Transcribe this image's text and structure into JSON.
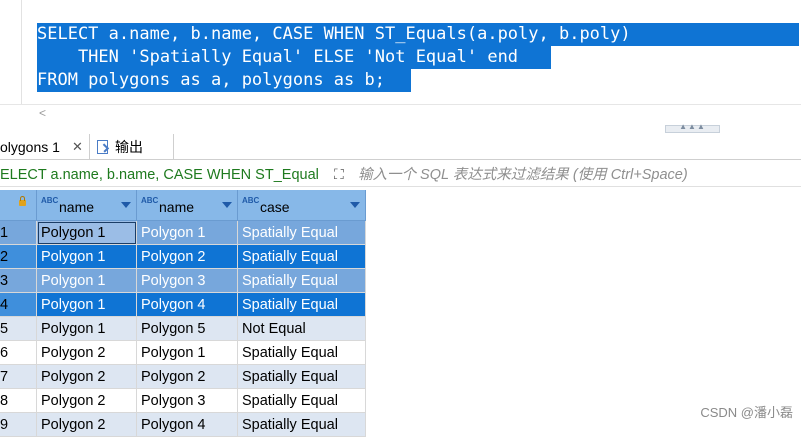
{
  "editor": {
    "sql_lines": [
      "SELECT a.name, b.name, CASE WHEN ST_Equals(a.poly, b.poly)",
      "    THEN 'Spatially Equal' ELSE 'Not Equal' end",
      "FROM polygons as a, polygons as b;"
    ],
    "scroll_left_arrow": "<",
    "sash_glyph": "▲▲▲"
  },
  "tabs": {
    "results_label": "olygons 1",
    "close_glyph": "✕",
    "output_label": "输出"
  },
  "filter": {
    "query_text": "ELECT a.name, b.name, CASE WHEN ST_Equal",
    "expand_glyph": "⛶",
    "placeholder": "输入一个 SQL 表达式来过滤结果 (使用 Ctrl+Space)"
  },
  "grid": {
    "columns": [
      {
        "type_badge": "ABC",
        "label": "name"
      },
      {
        "type_badge": "ABC",
        "label": "name"
      },
      {
        "type_badge": "ABC",
        "label": "case"
      }
    ],
    "rows": [
      {
        "num": "1",
        "a": "Polygon 1",
        "b": "Polygon 1",
        "case": "Spatially Equal"
      },
      {
        "num": "2",
        "a": "Polygon 1",
        "b": "Polygon 2",
        "case": "Spatially Equal"
      },
      {
        "num": "3",
        "a": "Polygon 1",
        "b": "Polygon 3",
        "case": "Spatially Equal"
      },
      {
        "num": "4",
        "a": "Polygon 1",
        "b": "Polygon 4",
        "case": "Spatially Equal"
      },
      {
        "num": "5",
        "a": "Polygon 1",
        "b": "Polygon 5",
        "case": "Not Equal"
      },
      {
        "num": "6",
        "a": "Polygon 2",
        "b": "Polygon 1",
        "case": "Spatially Equal"
      },
      {
        "num": "7",
        "a": "Polygon 2",
        "b": "Polygon 2",
        "case": "Spatially Equal"
      },
      {
        "num": "8",
        "a": "Polygon 2",
        "b": "Polygon 3",
        "case": "Spatially Equal"
      },
      {
        "num": "9",
        "a": "Polygon 2",
        "b": "Polygon 4",
        "case": "Spatially Equal"
      }
    ]
  },
  "watermark": "CSDN @潘小磊",
  "colors": {
    "selection_dark": "#0f74d4",
    "selection_light": "#77a7dc",
    "header_bg": "#87b8e8",
    "stripe": "#dde6f2",
    "query_text": "#1e7a1e"
  }
}
